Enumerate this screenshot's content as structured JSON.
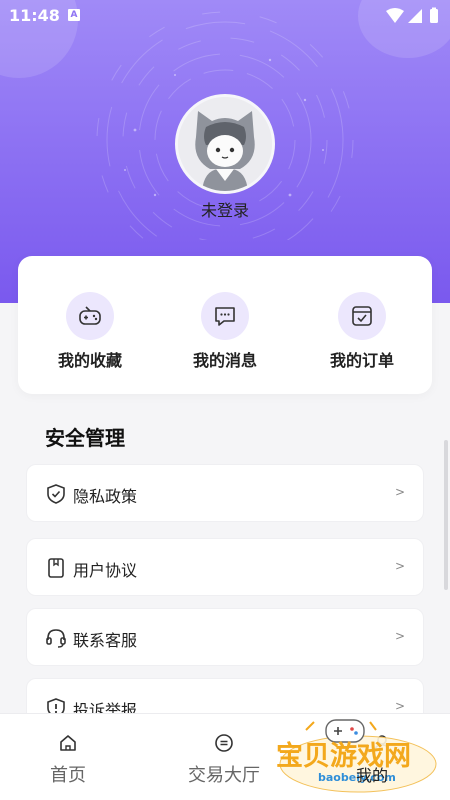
{
  "status_bar": {
    "time": "11:48",
    "notification_letter": "A"
  },
  "profile": {
    "login_status": "未登录"
  },
  "quick_actions": [
    {
      "label": "我的收藏",
      "icon": "gamepad-icon"
    },
    {
      "label": "我的消息",
      "icon": "message-icon"
    },
    {
      "label": "我的订单",
      "icon": "order-icon"
    }
  ],
  "security": {
    "title": "安全管理",
    "items": [
      {
        "label": "隐私政策",
        "icon": "shield-icon",
        "arrow": ">"
      },
      {
        "label": "用户协议",
        "icon": "document-icon",
        "arrow": ">"
      },
      {
        "label": "联系客服",
        "icon": "headset-icon",
        "arrow": ">"
      },
      {
        "label": "投诉举报",
        "icon": "report-icon",
        "arrow": ">"
      }
    ]
  },
  "bottom_nav": [
    {
      "label": "首页",
      "icon": "home-icon"
    },
    {
      "label": "交易大厅",
      "icon": "trade-icon"
    },
    {
      "label": "我的",
      "icon": "user-icon"
    }
  ],
  "watermark": {
    "text": "宝贝游戏网",
    "url": "baobeiy.com"
  },
  "colors": {
    "accent": "#8e73f3",
    "icon_bg": "#ece7fd"
  }
}
